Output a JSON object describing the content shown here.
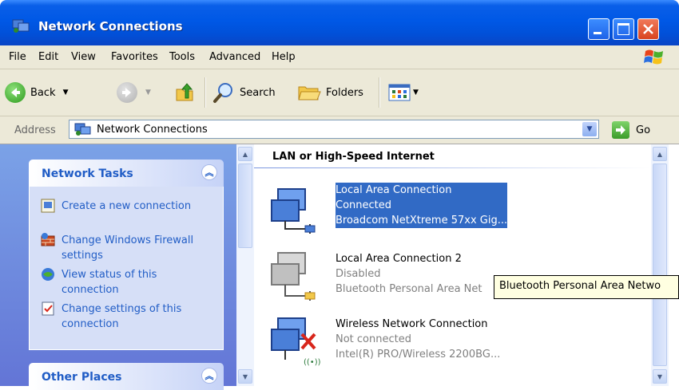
{
  "window": {
    "title": "Network Connections"
  },
  "menu": {
    "items": [
      "File",
      "Edit",
      "View",
      "Favorites",
      "Tools",
      "Advanced",
      "Help"
    ]
  },
  "toolbar": {
    "back_label": "Back",
    "search_label": "Search",
    "folders_label": "Folders"
  },
  "address": {
    "label": "Address",
    "value": "Network Connections",
    "go_label": "Go"
  },
  "sidebar": {
    "network_tasks": {
      "title": "Network Tasks",
      "items": [
        {
          "label": "Create a new connection",
          "icon": "new-connection-icon"
        },
        {
          "label": "Change Windows Firewall settings",
          "icon": "firewall-icon"
        },
        {
          "label": "View status of this connection",
          "icon": "status-icon"
        },
        {
          "label": "Change settings of this connection",
          "icon": "settings-icon"
        }
      ]
    },
    "other_places": {
      "title": "Other Places"
    }
  },
  "content": {
    "group_title": "LAN or High-Speed Internet",
    "connections": [
      {
        "name": "Local Area Connection",
        "status": "Connected",
        "device": "Broadcom NetXtreme 57xx Gig...",
        "selected": true
      },
      {
        "name": "Local Area Connection 2",
        "status": "Disabled",
        "device": "Bluetooth Personal Area Net",
        "selected": false
      },
      {
        "name": "Wireless Network Connection",
        "status": "Not connected",
        "device": "Intel(R) PRO/Wireless 2200BG...",
        "selected": false
      }
    ]
  },
  "tooltip": {
    "text": "Bluetooth Personal Area Netwo"
  },
  "colors": {
    "title_bar": "#0058e6",
    "task_link": "#215dc6",
    "selection": "#316ac5",
    "tooltip_bg": "#ffffe1"
  }
}
